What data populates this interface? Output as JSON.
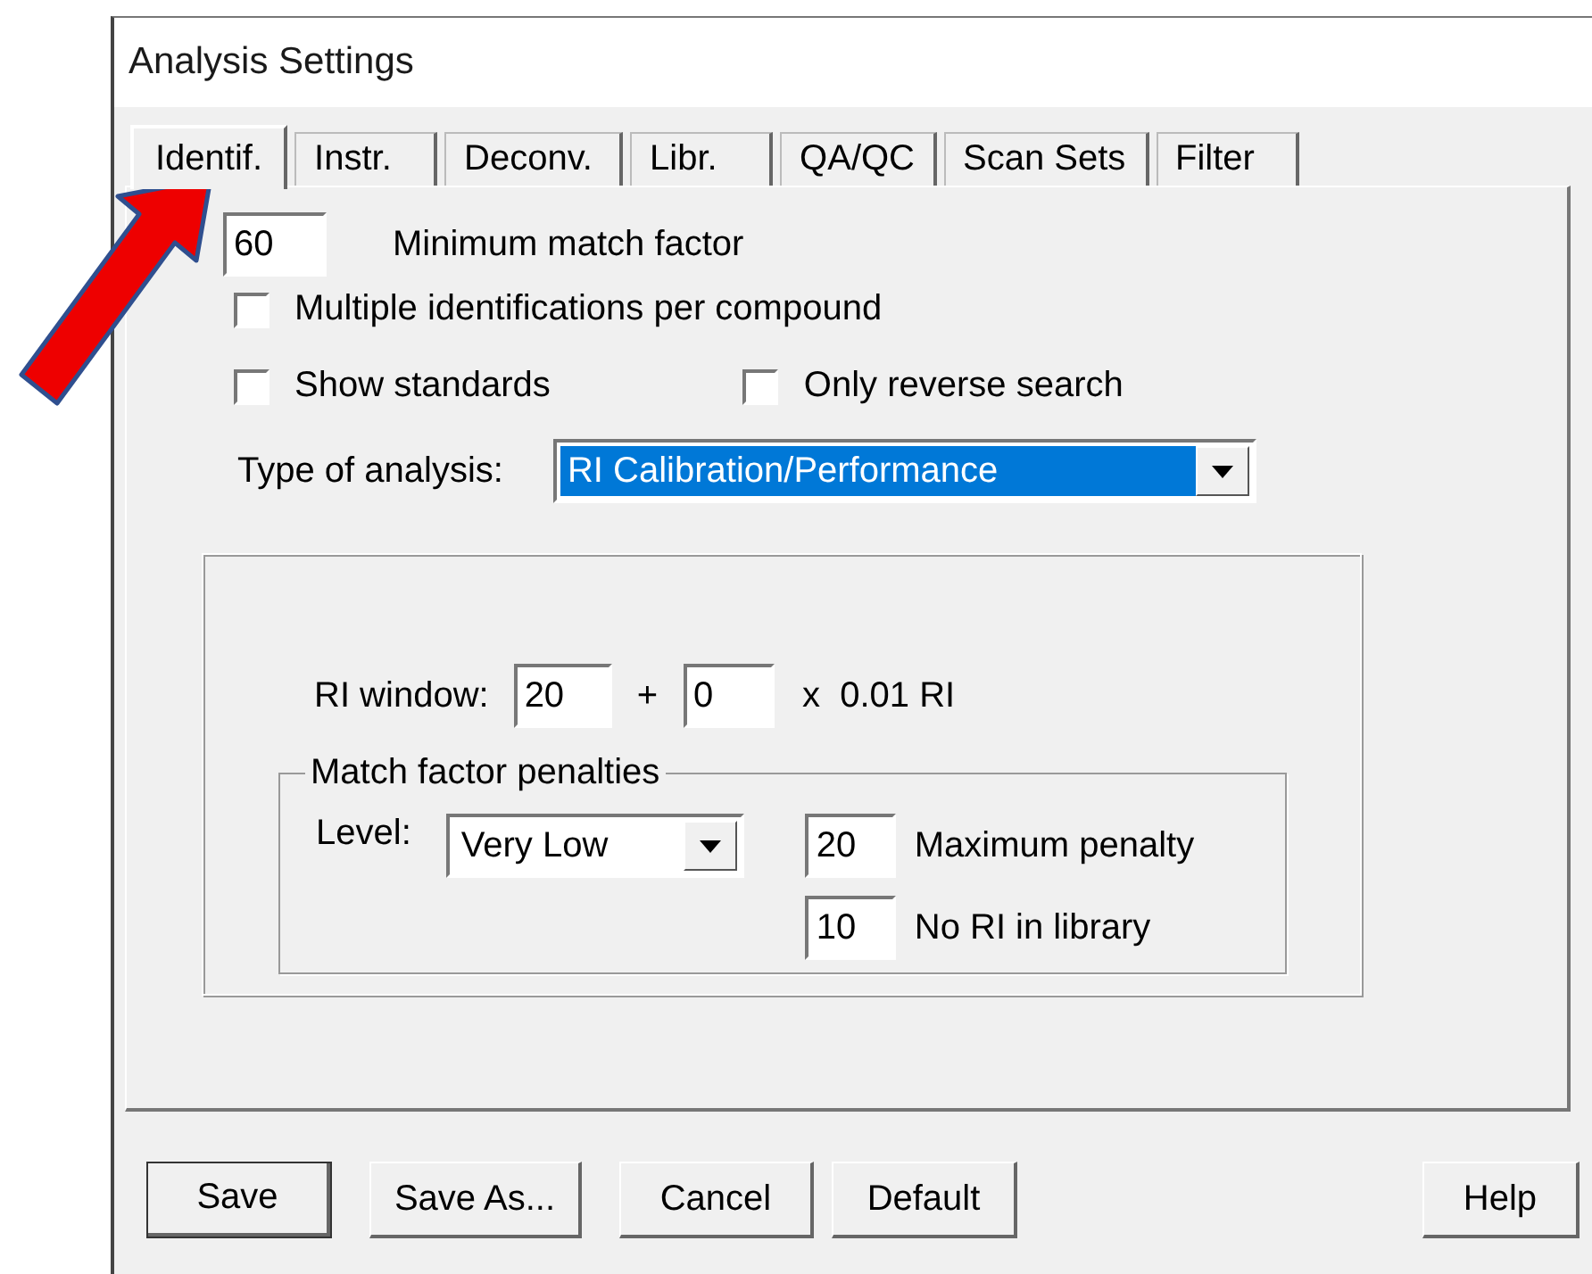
{
  "window": {
    "title": "Analysis Settings"
  },
  "tabs": [
    {
      "label": "Identif.",
      "selected": true
    },
    {
      "label": "Instr.",
      "selected": false
    },
    {
      "label": "Deconv.",
      "selected": false
    },
    {
      "label": "Libr.",
      "selected": false
    },
    {
      "label": "QA/QC",
      "selected": false
    },
    {
      "label": "Scan Sets",
      "selected": false
    },
    {
      "label": "Filter",
      "selected": false
    }
  ],
  "minimum_match_factor": {
    "value": "60",
    "label": "Minimum match factor"
  },
  "checkboxes": [
    {
      "label": "Multiple identifications per compound",
      "checked": false
    },
    {
      "label": "Show standards",
      "checked": false
    },
    {
      "label": "Only reverse search",
      "checked": false
    }
  ],
  "type_of_analysis": {
    "label": "Type of analysis:",
    "value": "RI Calibration/Performance",
    "focused": true
  },
  "ri_window": {
    "label": "RI window:",
    "value_1": "20",
    "plus": "+",
    "value_2": "0",
    "unit": "x  0.01 RI"
  },
  "match_factor_penalties": {
    "title": "Match factor penalties",
    "level_label": "Level:",
    "level": "Very Low",
    "fields": [
      {
        "value": "20",
        "label": "Maximum penalty"
      },
      {
        "value": "10",
        "label": "No RI in library"
      }
    ]
  },
  "buttons": [
    {
      "label": "Save",
      "default": true
    },
    {
      "label": "Save As...",
      "default": false
    },
    {
      "label": "Cancel",
      "default": false
    },
    {
      "label": "Default",
      "default": false
    },
    {
      "label": "Help",
      "default": false
    }
  ]
}
